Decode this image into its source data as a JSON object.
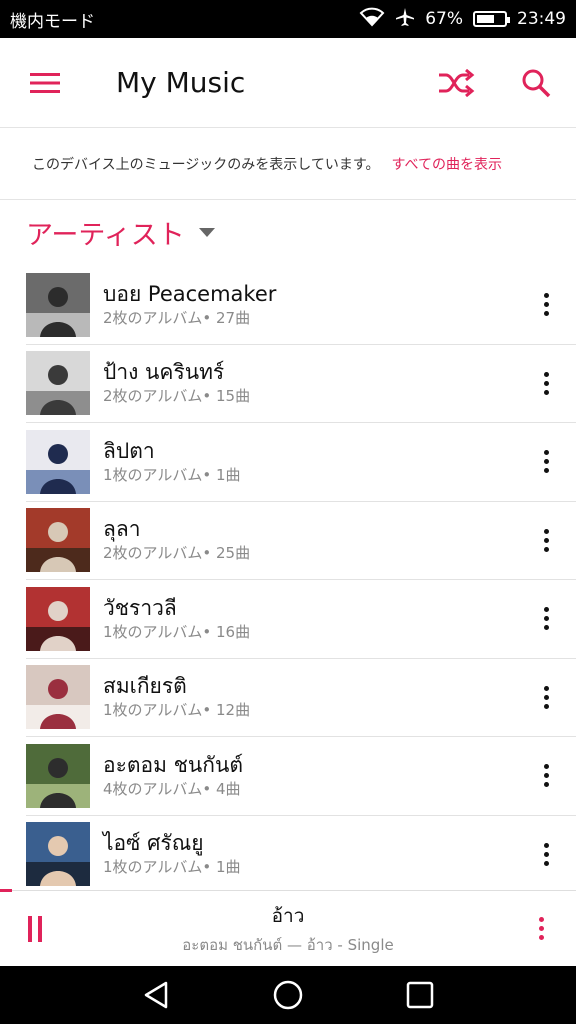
{
  "status_bar": {
    "mode": "機内モード",
    "battery": "67%",
    "battery_level": 0.67,
    "time": "23:49"
  },
  "app_bar": {
    "title": "My Music"
  },
  "notice": {
    "text": "このデバイス上のミュージックのみを表示しています。",
    "link": "すべての曲を表示"
  },
  "section": {
    "title": "アーティスト"
  },
  "artists": [
    {
      "name": "บอย Peacemaker",
      "meta": "2枚のアルバム• 27曲"
    },
    {
      "name": "ป้าง นครินทร์",
      "meta": "2枚のアルバム• 15曲"
    },
    {
      "name": "ลิปตา",
      "meta": "1枚のアルバム• 1曲"
    },
    {
      "name": "ลุลา",
      "meta": "2枚のアルバム• 25曲"
    },
    {
      "name": "วัชราวลี",
      "meta": "1枚のアルバム• 16曲"
    },
    {
      "name": "สมเกียรติ",
      "meta": "1枚のアルバム• 12曲"
    },
    {
      "name": "อะตอม ชนกันต์",
      "meta": "4枚のアルバム• 4曲"
    },
    {
      "name": "ไอซ์ ศรัณยู",
      "meta": "1枚のアルバム• 1曲"
    }
  ],
  "now_playing": {
    "title": "อ้าว",
    "subtitle": "อะตอม ชนกันต์ — อ้าว - Single",
    "progress": 0.02
  },
  "colors": {
    "accent": "#e0235a"
  }
}
